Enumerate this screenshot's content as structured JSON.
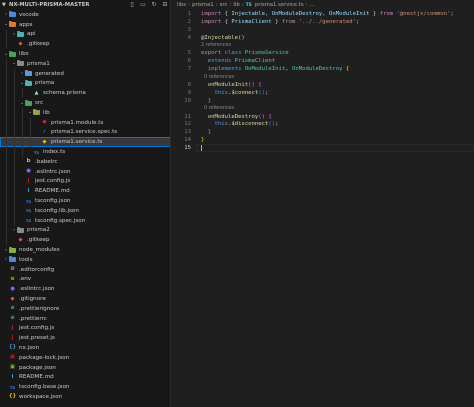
{
  "explorer": {
    "title": "NX-MULTI-PRISMA-MASTER",
    "actions": [
      "new-file-icon",
      "new-folder-icon",
      "refresh-icon",
      "collapse-icon"
    ],
    "items": [
      {
        "label": "vscode",
        "type": "folder",
        "depth": 0,
        "arrow": "closed",
        "color": "#4a8cd6",
        "icon_text": ""
      },
      {
        "label": "apps",
        "type": "folder",
        "depth": 0,
        "arrow": "open",
        "color": "#d97b3a",
        "icon_text": ""
      },
      {
        "label": "api",
        "type": "folder",
        "depth": 1,
        "arrow": "closed",
        "color": "#4fb3b3",
        "icon_text": ""
      },
      {
        "label": ".gitkeep",
        "type": "file",
        "depth": 1,
        "arrow": "none",
        "color": "#e9573f",
        "icon_text": "◆"
      },
      {
        "label": "libs",
        "type": "folder",
        "depth": 0,
        "arrow": "open",
        "color": "#4aa35d",
        "icon_text": ""
      },
      {
        "label": "prisma1",
        "type": "folder",
        "depth": 1,
        "arrow": "open",
        "color": "#8b8b8b",
        "icon_text": ""
      },
      {
        "label": "generated",
        "type": "folder",
        "depth": 2,
        "arrow": "closed",
        "color": "#5b9bd5",
        "icon_text": ""
      },
      {
        "label": "prisma",
        "type": "folder",
        "depth": 2,
        "arrow": "open",
        "color": "#4fb3b3",
        "icon_text": ""
      },
      {
        "label": "schema.prisma",
        "type": "file",
        "depth": 3,
        "arrow": "none",
        "color": "#8fd0e6",
        "icon_text": "▲"
      },
      {
        "label": "src",
        "type": "folder",
        "depth": 2,
        "arrow": "open",
        "color": "#4aa35d",
        "icon_text": ""
      },
      {
        "label": "lib",
        "type": "folder",
        "depth": 3,
        "arrow": "open",
        "color": "#9aa04a",
        "icon_text": ""
      },
      {
        "label": "prisma1.module.ts",
        "type": "file",
        "depth": 4,
        "arrow": "none",
        "color": "#e0234e",
        "icon_text": "◆"
      },
      {
        "label": "prisma1.service.spec.ts",
        "type": "file",
        "depth": 4,
        "arrow": "none",
        "color": "#2f9df4",
        "icon_text": "✓"
      },
      {
        "label": "prisma1.service.ts",
        "type": "file",
        "depth": 4,
        "arrow": "none",
        "color": "#e5c100",
        "icon_text": "◆",
        "selected": true
      },
      {
        "label": "index.ts",
        "type": "file",
        "depth": 3,
        "arrow": "none",
        "color": "#3b82f6",
        "icon_text": "TS"
      },
      {
        "label": ".babelrc",
        "type": "file",
        "depth": 2,
        "arrow": "none",
        "color": "#e5c100",
        "icon_text": "b"
      },
      {
        "label": ".eslintrc.json",
        "type": "file",
        "depth": 2,
        "arrow": "none",
        "color": "#7b68ee",
        "icon_text": "●"
      },
      {
        "label": "jest.config.js",
        "type": "file",
        "depth": 2,
        "arrow": "none",
        "color": "#c21325",
        "icon_text": "J"
      },
      {
        "label": "README.md",
        "type": "file",
        "depth": 2,
        "arrow": "none",
        "color": "#42a5f5",
        "icon_text": "i"
      },
      {
        "label": "tsconfig.json",
        "type": "file",
        "depth": 2,
        "arrow": "none",
        "color": "#3b82f6",
        "icon_text": "TS"
      },
      {
        "label": "tsconfig.lib.json",
        "type": "file",
        "depth": 2,
        "arrow": "none",
        "color": "#3b82f6",
        "icon_text": "TS"
      },
      {
        "label": "tsconfig.spec.json",
        "type": "file",
        "depth": 2,
        "arrow": "none",
        "color": "#3b82f6",
        "icon_text": "TS"
      },
      {
        "label": "prisma2",
        "type": "folder",
        "depth": 1,
        "arrow": "closed",
        "color": "#8b8b8b",
        "icon_text": ""
      },
      {
        "label": ".gitkeep",
        "type": "file",
        "depth": 1,
        "arrow": "none",
        "color": "#e9573f",
        "icon_text": "◆"
      },
      {
        "label": "node_modules",
        "type": "folder",
        "depth": 0,
        "arrow": "closed",
        "color": "#7cb342",
        "icon_text": ""
      },
      {
        "label": "tools",
        "type": "folder",
        "depth": 0,
        "arrow": "closed",
        "color": "#4a8cd6",
        "icon_text": ""
      },
      {
        "label": ".editorconfig",
        "type": "file",
        "depth": 0,
        "arrow": "none",
        "color": "#cccccc",
        "icon_text": "⚙"
      },
      {
        "label": ".env",
        "type": "file",
        "depth": 0,
        "arrow": "none",
        "color": "#e5c100",
        "icon_text": "≡"
      },
      {
        "label": ".eslintrc.json",
        "type": "file",
        "depth": 0,
        "arrow": "none",
        "color": "#7b68ee",
        "icon_text": "●"
      },
      {
        "label": ".gitignore",
        "type": "file",
        "depth": 0,
        "arrow": "none",
        "color": "#e9573f",
        "icon_text": "◆"
      },
      {
        "label": ".prettierignore",
        "type": "file",
        "depth": 0,
        "arrow": "none",
        "color": "#56b3b4",
        "icon_text": "≡"
      },
      {
        "label": ".prettierrc",
        "type": "file",
        "depth": 0,
        "arrow": "none",
        "color": "#56b3b4",
        "icon_text": "≡"
      },
      {
        "label": "jest.config.js",
        "type": "file",
        "depth": 0,
        "arrow": "none",
        "color": "#c21325",
        "icon_text": "J"
      },
      {
        "label": "jest.preset.js",
        "type": "file",
        "depth": 0,
        "arrow": "none",
        "color": "#c21325",
        "icon_text": "J"
      },
      {
        "label": "nx.json",
        "type": "file",
        "depth": 0,
        "arrow": "none",
        "color": "#4a90d9",
        "icon_text": "{}"
      },
      {
        "label": "package-lock.json",
        "type": "file",
        "depth": 0,
        "arrow": "none",
        "color": "#c12127",
        "icon_text": "▣"
      },
      {
        "label": "package.json",
        "type": "file",
        "depth": 0,
        "arrow": "none",
        "color": "#8bc34a",
        "icon_text": "▣"
      },
      {
        "label": "README.md",
        "type": "file",
        "depth": 0,
        "arrow": "none",
        "color": "#42a5f5",
        "icon_text": "i"
      },
      {
        "label": "tsconfig.base.json",
        "type": "file",
        "depth": 0,
        "arrow": "none",
        "color": "#3b82f6",
        "icon_text": "TS"
      },
      {
        "label": "workspace.json",
        "type": "file",
        "depth": 0,
        "arrow": "none",
        "color": "#e5c100",
        "icon_text": "{}"
      }
    ]
  },
  "breadcrumbs": [
    "libs",
    "prisma1",
    "src",
    "lib",
    "prisma1.service.ts",
    "..."
  ],
  "breadcrumb_file_icon": "TS",
  "code": [
    {
      "kind": "line",
      "n": "1",
      "tokens": [
        [
          "kw",
          "import"
        ],
        [
          "punc",
          " { "
        ],
        [
          "var",
          "Injectable"
        ],
        [
          "punc",
          ", "
        ],
        [
          "var",
          "OnModuleDestroy"
        ],
        [
          "punc",
          ", "
        ],
        [
          "var",
          "OnModuleInit"
        ],
        [
          "punc",
          " } "
        ],
        [
          "kw",
          "from"
        ],
        [
          "punc",
          " "
        ],
        [
          "str",
          "'@nestjs/common'"
        ],
        [
          "punc",
          ";"
        ]
      ]
    },
    {
      "kind": "line",
      "n": "2",
      "tokens": [
        [
          "kw",
          "import"
        ],
        [
          "punc",
          " { "
        ],
        [
          "var",
          "PrismaClient"
        ],
        [
          "punc",
          " } "
        ],
        [
          "kw",
          "from"
        ],
        [
          "punc",
          " "
        ],
        [
          "str",
          "'../../generated'"
        ],
        [
          "punc",
          ";"
        ]
      ]
    },
    {
      "kind": "line",
      "n": "3",
      "tokens": []
    },
    {
      "kind": "line",
      "n": "4",
      "tokens": [
        [
          "dec",
          "@Injectable"
        ],
        [
          "brace1",
          "()"
        ]
      ]
    },
    {
      "kind": "lens",
      "text": "2 references"
    },
    {
      "kind": "line",
      "n": "5",
      "tokens": [
        [
          "kw",
          "export"
        ],
        [
          "punc",
          " "
        ],
        [
          "kw2",
          "class"
        ],
        [
          "punc",
          " "
        ],
        [
          "cls",
          "PrismaService"
        ]
      ]
    },
    {
      "kind": "line",
      "n": "6",
      "tokens": [
        [
          "punc",
          "  "
        ],
        [
          "kw2",
          "extends"
        ],
        [
          "punc",
          " "
        ],
        [
          "cls",
          "PrismaClient"
        ]
      ]
    },
    {
      "kind": "line",
      "n": "7",
      "tokens": [
        [
          "punc",
          "  "
        ],
        [
          "kw2",
          "implements"
        ],
        [
          "punc",
          " "
        ],
        [
          "cls",
          "OnModuleInit"
        ],
        [
          "punc",
          ", "
        ],
        [
          "cls",
          "OnModuleDestroy"
        ],
        [
          "punc",
          " "
        ],
        [
          "brace1",
          "{"
        ]
      ]
    },
    {
      "kind": "lens",
      "text": "  0 references"
    },
    {
      "kind": "line",
      "n": "8",
      "tokens": [
        [
          "punc",
          "  "
        ],
        [
          "fn",
          "onModuleInit"
        ],
        [
          "brace2",
          "()"
        ],
        [
          "punc",
          " "
        ],
        [
          "brace2",
          "{"
        ]
      ]
    },
    {
      "kind": "line",
      "n": "9",
      "tokens": [
        [
          "punc",
          "    "
        ],
        [
          "kw2",
          "this"
        ],
        [
          "punc",
          "."
        ],
        [
          "fn",
          "$connect"
        ],
        [
          "brace3",
          "()"
        ],
        [
          "punc",
          ";"
        ]
      ]
    },
    {
      "kind": "line",
      "n": "10",
      "tokens": [
        [
          "punc",
          "  "
        ],
        [
          "brace2",
          "}"
        ]
      ]
    },
    {
      "kind": "lens",
      "text": "  0 references"
    },
    {
      "kind": "line",
      "n": "11",
      "tokens": [
        [
          "punc",
          "  "
        ],
        [
          "fn",
          "onModuleDestroy"
        ],
        [
          "brace2",
          "()"
        ],
        [
          "punc",
          " "
        ],
        [
          "brace2",
          "{"
        ]
      ]
    },
    {
      "kind": "line",
      "n": "12",
      "tokens": [
        [
          "punc",
          "    "
        ],
        [
          "kw2",
          "this"
        ],
        [
          "punc",
          "."
        ],
        [
          "fn",
          "$disconnect"
        ],
        [
          "brace3",
          "()"
        ],
        [
          "punc",
          ";"
        ]
      ]
    },
    {
      "kind": "line",
      "n": "13",
      "tokens": [
        [
          "punc",
          "  "
        ],
        [
          "brace2",
          "}"
        ]
      ]
    },
    {
      "kind": "line",
      "n": "14",
      "tokens": [
        [
          "brace1",
          "}"
        ]
      ]
    },
    {
      "kind": "line",
      "n": "15",
      "tokens": [],
      "active": true,
      "cursor": true
    }
  ]
}
